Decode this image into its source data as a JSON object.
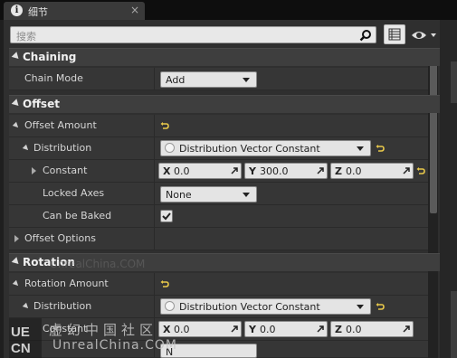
{
  "tab": {
    "title": "细节",
    "icon": "info-icon",
    "close": "×"
  },
  "search": {
    "placeholder": "搜索"
  },
  "categories": {
    "chaining": "Chaining",
    "offset": "Offset",
    "rotation": "Rotation"
  },
  "chaining": {
    "chain_mode": {
      "label": "Chain Mode",
      "value": "Add"
    }
  },
  "offset": {
    "offset_amount": "Offset Amount",
    "distribution": {
      "label": "Distribution",
      "value": "Distribution Vector Constant"
    },
    "constant": {
      "label": "Constant",
      "x": {
        "axis": "X",
        "value": "0.0"
      },
      "y": {
        "axis": "Y",
        "value": "300.0"
      },
      "z": {
        "axis": "Z",
        "value": "0.0"
      }
    },
    "locked_axes": {
      "label": "Locked Axes",
      "value": "None"
    },
    "can_be_baked": {
      "label": "Can be Baked",
      "checked": true
    },
    "offset_options": "Offset Options"
  },
  "rotation": {
    "rotation_amount": "Rotation Amount",
    "distribution": {
      "label": "Distribution",
      "value": "Distribution Vector Constant"
    },
    "constant": {
      "label": "Constant",
      "x": {
        "axis": "X",
        "value": "0.0"
      },
      "y": {
        "axis": "Y",
        "value": "0.0"
      },
      "z": {
        "axis": "Z",
        "value": "0.0"
      }
    },
    "next_value": "N"
  },
  "watermark": {
    "logo_text": "UECN",
    "cn": "虚幻中国社区",
    "en": "UnrealChina.COM",
    "faint": "UnrealChina.COM"
  },
  "colors": {
    "panel": "#2f2f2f",
    "category": "#3e3e3e",
    "field": "#e4e4e4",
    "reset": "#e8c84a"
  }
}
